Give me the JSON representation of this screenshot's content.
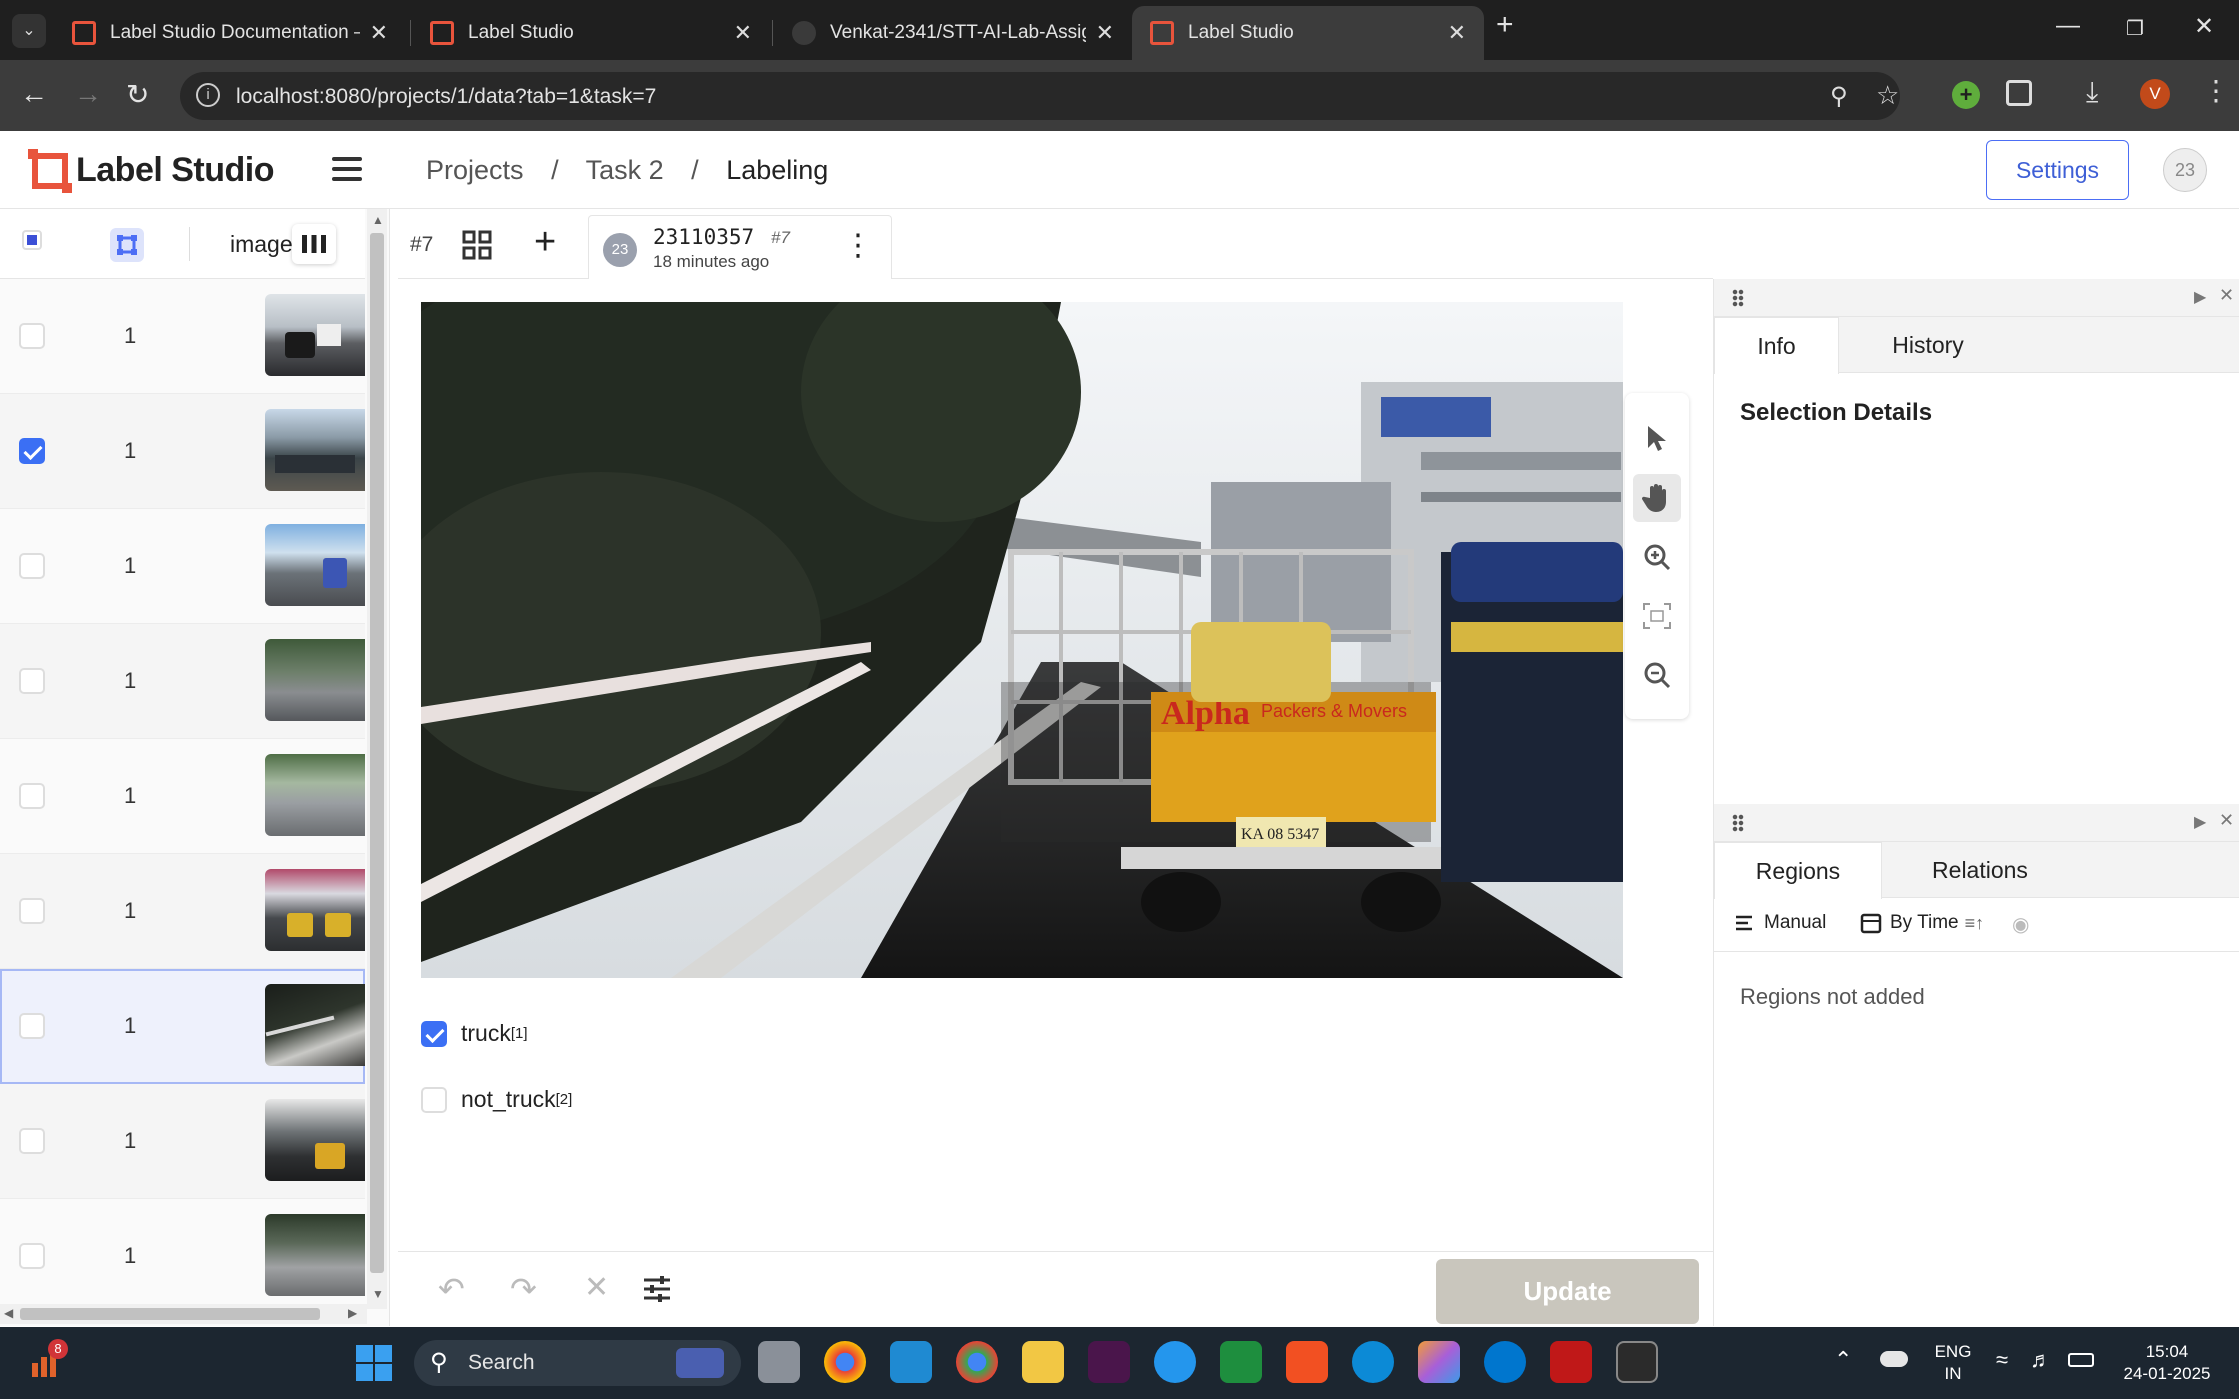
{
  "browser": {
    "tabs": [
      {
        "title": "Label Studio Documentation —",
        "active": false
      },
      {
        "title": "Label Studio",
        "active": false
      },
      {
        "title": "Venkat-2341/STT-AI-Lab-Assign",
        "active": false
      },
      {
        "title": "Label Studio",
        "active": true
      }
    ],
    "url": "localhost:8080/projects/1/data?tab=1&task=7",
    "profile_initial": "V"
  },
  "app": {
    "brand": "Label Studio",
    "breadcrumbs": [
      "Projects",
      "/",
      "Task 2",
      "/",
      "Labeling"
    ],
    "settings_label": "Settings",
    "user_avatar": "23"
  },
  "tasklist": {
    "column_label": "image",
    "rows": [
      {
        "count": "1",
        "checked": false,
        "selected": false
      },
      {
        "count": "1",
        "checked": true,
        "selected": false
      },
      {
        "count": "1",
        "checked": false,
        "selected": false
      },
      {
        "count": "1",
        "checked": false,
        "selected": false
      },
      {
        "count": "1",
        "checked": false,
        "selected": false
      },
      {
        "count": "1",
        "checked": false,
        "selected": false
      },
      {
        "count": "1",
        "checked": false,
        "selected": true
      },
      {
        "count": "1",
        "checked": false,
        "selected": false
      },
      {
        "count": "1",
        "checked": false,
        "selected": false
      }
    ]
  },
  "labeling": {
    "task_id": "#7",
    "annotation": {
      "avatar": "23",
      "user": "23110357",
      "id": "#7",
      "time": "18 minutes ago"
    },
    "choices": [
      {
        "label": "truck",
        "hotkey": "[1]",
        "checked": true
      },
      {
        "label": "not_truck",
        "hotkey": "[2]",
        "checked": false
      }
    ],
    "update_label": "Update",
    "truck_plate_text": "Alpha Packers & Movers"
  },
  "right_panel": {
    "top_tabs": [
      "Info",
      "History"
    ],
    "selection_title": "Selection Details",
    "bottom_tabs": [
      "Regions",
      "Relations"
    ],
    "manual_label": "Manual",
    "bytime_label": "By Time",
    "empty_regions": "Regions not added"
  },
  "taskbar": {
    "search_label": "Search",
    "notification_count": "8",
    "lang_top": "ENG",
    "lang_bottom": "IN",
    "time": "15:04",
    "date": "24-01-2025"
  },
  "colors": {
    "accent": "#3b6ff4",
    "brand": "#e8543c",
    "update_disabled": "#c9c6bd"
  }
}
